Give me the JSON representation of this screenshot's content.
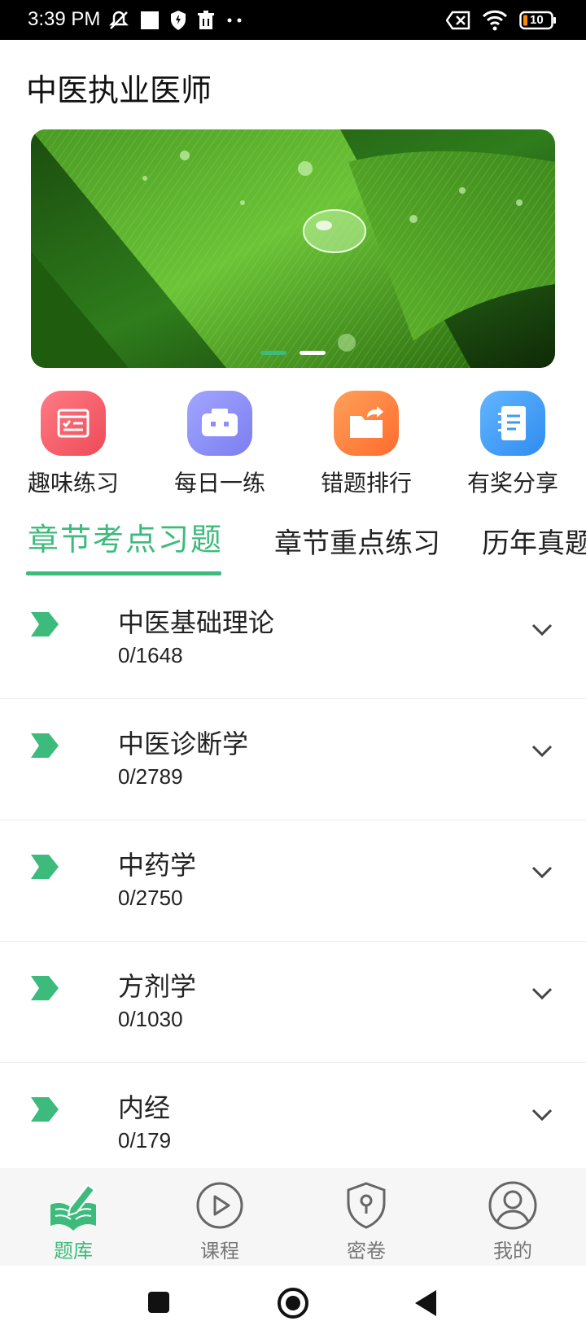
{
  "status_bar": {
    "time": "3:39 PM",
    "battery": "10",
    "icons_left": [
      "mute-icon",
      "square-icon",
      "shield-icon",
      "trash-icon",
      "more-dots-icon"
    ],
    "icons_right": [
      "close-box-icon",
      "wifi-icon",
      "battery-icon"
    ]
  },
  "header": {
    "title": "中医执业医师"
  },
  "banner": {
    "image": "green-leaf-water-drop",
    "slides": 2,
    "active_slide": 0
  },
  "quick_actions": [
    {
      "label": "趣味练习",
      "icon": "calendar-check-icon",
      "color": "#f25a67"
    },
    {
      "label": "每日一练",
      "icon": "robot-icon",
      "color": "#8d8ff7"
    },
    {
      "label": "错题排行",
      "icon": "folder-share-icon",
      "color": "#ff7a3d"
    },
    {
      "label": "有奖分享",
      "icon": "notebook-icon",
      "color": "#3d9bf7"
    }
  ],
  "tabs": [
    {
      "label": "章节考点习题",
      "active": true
    },
    {
      "label": "章节重点练习",
      "active": false
    },
    {
      "label": "历年真题",
      "active": false
    }
  ],
  "chapters": [
    {
      "name": "中医基础理论",
      "progress": "0/1648"
    },
    {
      "name": "中医诊断学",
      "progress": "0/2789"
    },
    {
      "name": "中药学",
      "progress": "0/2750"
    },
    {
      "name": "方剂学",
      "progress": "0/1030"
    },
    {
      "name": "内经",
      "progress": "0/179"
    }
  ],
  "bottom_nav": [
    {
      "label": "题库",
      "icon": "book-pen-icon",
      "active": true
    },
    {
      "label": "课程",
      "icon": "play-circle-icon",
      "active": false
    },
    {
      "label": "密卷",
      "icon": "lock-shield-icon",
      "active": false
    },
    {
      "label": "我的",
      "icon": "user-circle-icon",
      "active": false
    }
  ],
  "colors": {
    "accent": "#3dbb7c",
    "text": "#222222",
    "muted": "#777777"
  }
}
